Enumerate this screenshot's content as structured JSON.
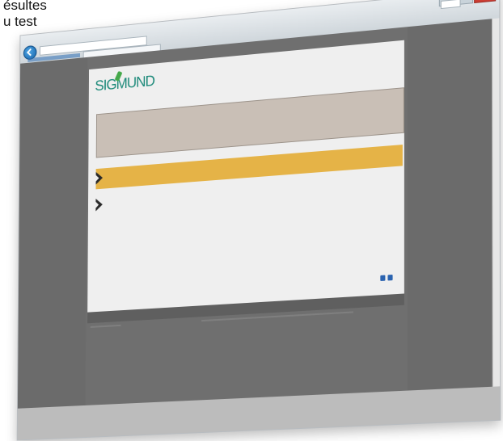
{
  "caption": {
    "line1": "ésultes",
    "line2": "u test"
  },
  "browser": {
    "url": "",
    "tab_title": "",
    "controls": [
      "minimize-icon",
      "maximize-icon",
      "close-icon"
    ]
  },
  "test": {
    "logo_text": "SIGMUND",
    "question": "",
    "answers": [
      {
        "text": "",
        "selected": true
      },
      {
        "text": "",
        "selected": false
      }
    ],
    "nav_icons": [
      "previous-icon",
      "next-icon"
    ]
  },
  "colors": {
    "accent": "#e5b347",
    "question_bg": "#c9bfb6",
    "logo": "#1d8a7a",
    "nav_icon": "#2b63b0",
    "close_button": "#cc3d33"
  }
}
